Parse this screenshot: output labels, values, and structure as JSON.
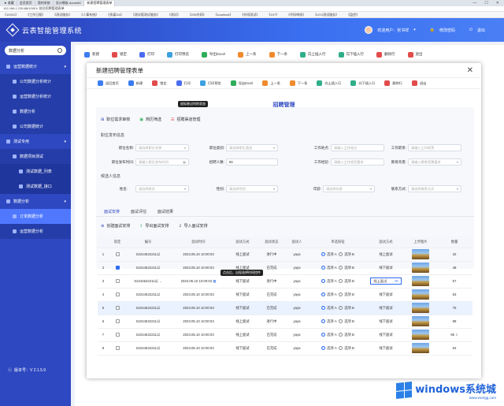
{
  "browser": {
    "tabs": [
      {
        "label": "★ 收藏"
      },
      {
        "label": "会员首页"
      },
      {
        "label": "我的系统"
      },
      {
        "label": "设计模板 Axure8C"
      },
      {
        "label": "新建招聘管理表单"
      }
    ],
    "window_controls": [
      "—",
      "☐",
      "✕"
    ],
    "address": "192.168.1.235:88/10001/ 前台招聘管理表单",
    "bookmarks": [
      "《10001》",
      "《工作日报》",
      "《测试服务》",
      "《人事系统》",
      "《多媒OA》",
      "《测试版测试服务》",
      "《测试》",
      "《235外网》",
      "《localhost》",
      "《外网测试》",
      "《197》",
      "《代码审阅》",
      "《LEO测试服务》",
      "《监控》"
    ]
  },
  "header": {
    "title": "云表智能管理系统",
    "user": "欢迎用户：张书祥",
    "change_password": "修改密码",
    "logout": "退出"
  },
  "sidebar": {
    "search_label": "数据分析",
    "items": [
      {
        "label": "运营数据统计",
        "level": 0
      },
      {
        "label": "公司数据分析统计",
        "level": 1
      },
      {
        "label": "运营数据分析统计",
        "level": 1
      },
      {
        "label": "数据分析",
        "level": 1
      },
      {
        "label": "公司数据统计",
        "level": 1
      },
      {
        "label": "测试专用",
        "level": 0
      },
      {
        "label": "数据项目测试",
        "level": 1
      },
      {
        "label": "测试数据_列表",
        "level": 2
      },
      {
        "label": "测试数据_接口",
        "level": 2
      },
      {
        "label": "数据分析",
        "level": 0
      },
      {
        "label": "订单数据分析",
        "level": 1,
        "active": true
      },
      {
        "label": "运营数据分析",
        "level": 1
      }
    ],
    "version": "版本号：V 2.1.5.9"
  },
  "bg_toolbar": [
    {
      "label": "新建",
      "color": "#3b7cf0"
    },
    {
      "label": "锁定",
      "color": "#e24b4b"
    },
    {
      "label": "打印",
      "color": "#4b6cf0"
    },
    {
      "label": "打印预览",
      "color": "#3ba0e0"
    },
    {
      "label": "导出Excel",
      "color": "#2fae5a"
    },
    {
      "label": "上一条",
      "color": "#f08a2d"
    },
    {
      "label": "下一条",
      "color": "#f08a2d"
    },
    {
      "label": "向上插入行",
      "color": "#2fae8a"
    },
    {
      "label": "向下插入行",
      "color": "#2fae8a"
    },
    {
      "label": "删除行",
      "color": "#e24b4b"
    },
    {
      "label": "退出",
      "color": "#e24b4b"
    }
  ],
  "modal": {
    "title": "新建招聘管理表单",
    "toolbar": [
      {
        "label": "返回首页",
        "color": "#3b7cf0"
      },
      {
        "label": "新建",
        "color": "#3b7cf0"
      },
      {
        "label": "锁定",
        "color": "#e24b4b"
      },
      {
        "label": "打印",
        "color": "#4b6cf0"
      },
      {
        "label": "打印预览",
        "color": "#3ba0e0"
      },
      {
        "label": "导出Excel",
        "color": "#2fae5a"
      },
      {
        "label": "上一条",
        "color": "#f08a2d"
      },
      {
        "label": "下一条",
        "color": "#f08a2d"
      },
      {
        "label": "向上插入行",
        "color": "#2fae8a"
      },
      {
        "label": "向下插入行",
        "color": "#2fae8a"
      },
      {
        "label": "删除行",
        "color": "#e24b4b"
      },
      {
        "label": "退出",
        "color": "#e24b4b"
      }
    ],
    "tooltip_print": "鼠标移过时的状态",
    "section_title": "招聘管理",
    "sub_actions": [
      "职位需求审核",
      "简历筛选",
      "招聘渠道管理"
    ],
    "group1_label": "职位发布信息",
    "group2_label": "候选人信息",
    "form": {
      "position_name": {
        "label": "职位名称:",
        "placeholder": "请选择职位名称"
      },
      "position_type": {
        "label": "职位类别:",
        "placeholder": "请选择职位类别"
      },
      "work_place": {
        "label": "工作地点:",
        "placeholder": "请输入工作地点"
      },
      "position_duty": {
        "label": "工作职责:",
        "placeholder": "请输入工作职责"
      },
      "publish_time": {
        "label": "职位发布时间:",
        "placeholder": "请输入职位发布时间"
      },
      "headcount": {
        "label": "招聘人数:",
        "value": "66"
      },
      "experience": {
        "label": "工作经验:",
        "placeholder": "请输入工作经验要求"
      },
      "education": {
        "label": "教育背景:",
        "placeholder": "请输入教育背景要求"
      },
      "name": {
        "label": "姓名:",
        "placeholder": "请选择姓名"
      },
      "gender": {
        "label": "性别:",
        "placeholder": "请选择性别"
      },
      "age": {
        "label": "年龄:",
        "placeholder": "请选择年龄"
      },
      "contact": {
        "label": "联系方式:",
        "placeholder": "请选择联系方式"
      }
    },
    "tabs": [
      "面试安排",
      "面试评估",
      "面试结果"
    ],
    "table_actions": [
      "创建面试安排",
      "导出面试安排",
      "导入面试安排"
    ],
    "tooltip_date": "点击后，出现选择时间控件",
    "columns": [
      "",
      "锁定",
      "编号",
      "面试时间",
      "面试方式",
      "面试状态",
      "面试人",
      "单选按钮",
      "面试方式",
      "上传图片",
      "数量"
    ],
    "rows": [
      {
        "idx": "1",
        "locked": false,
        "code": "S2244522211以",
        "time": "2023.05.10 10:00:03",
        "mode": "线上面试",
        "status": "进行中",
        "person": "yaya",
        "radio_a": "选项 A",
        "radio_b": "选项 B",
        "sel": "a",
        "mode2": "线上面试",
        "qty": "32"
      },
      {
        "idx": "2",
        "locked": true,
        "code": "S2244522211以",
        "time": "2023.05.10 10:00:03",
        "mode": "线上面试",
        "status": "已完成",
        "person": "yaya",
        "radio_a": "选项 A",
        "radio_b": "选项 B",
        "sel": "a",
        "mode2": "线下面试",
        "qty": "48"
      },
      {
        "idx": "3",
        "locked": false,
        "code": "S2244522211以",
        "time": "2023.05.10 10:00:03",
        "mode": "线下面试",
        "status": "进行中",
        "person": "yaya",
        "radio_a": "选项 A",
        "radio_b": "选项 B",
        "sel": "a",
        "mode2": "线上面试",
        "qty": "57"
      },
      {
        "idx": "4",
        "locked": false,
        "code": "S2244522211以",
        "time": "2023.05.10 10:00:03",
        "mode": "线下面试",
        "status": "已完成",
        "person": "yaya",
        "radio_a": "选项 A",
        "radio_b": "选项 B",
        "sel": "a",
        "mode2": "线下面试",
        "qty": "63"
      },
      {
        "idx": "5",
        "locked": false,
        "code": "S2244522211以",
        "time": "2023.05.10 10:00:03",
        "mode": "线下面试",
        "status": "已完成",
        "person": "yaya",
        "radio_a": "选项 A",
        "radio_b": "选项 B",
        "sel": "a",
        "mode2": "线下面试",
        "qty": "75"
      },
      {
        "idx": "6",
        "locked": false,
        "code": "S2244522211以",
        "time": "2023.05.10 10:00:03",
        "mode": "线上面试",
        "status": "进行中",
        "person": "yaya",
        "radio_a": "选项 A",
        "radio_b": "选项 B",
        "sel": "a",
        "mode2": "线下面试",
        "qty": "88"
      },
      {
        "idx": "7",
        "locked": false,
        "code": "S2244522211以",
        "time": "2023.05.10 10:00:03",
        "mode": "线上面试",
        "status": "已完成",
        "person": "yaya",
        "radio_a": "选项 A",
        "radio_b": "选项 B",
        "sel": "a",
        "mode2": "线下面试",
        "qty": "96"
      },
      {
        "idx": "8",
        "locked": false,
        "code": "S2244522211以",
        "time": "2023.05.10 10:00:03",
        "mode": "线下面试",
        "status": "已完成",
        "person": "yaya",
        "radio_a": "选项 A",
        "radio_b": "选项 B",
        "sel": "a",
        "mode2": "线下面试",
        "qty": "62"
      }
    ]
  },
  "watermark": {
    "title": "windows系统城",
    "sub": "www.wxclgg.com"
  }
}
